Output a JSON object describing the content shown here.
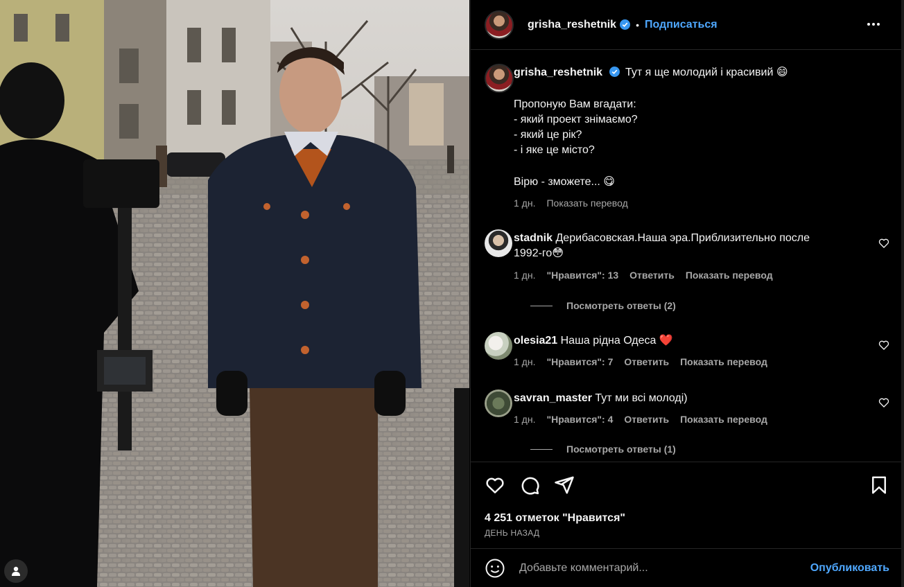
{
  "post": {
    "image_alt": "Photo of a man in a navy coat on a cobblestone street being filmed"
  },
  "header": {
    "username": "grisha_reshetnik",
    "separator": "•",
    "follow_label": "Подписаться",
    "more_icon": "more-horizontal-icon"
  },
  "caption": {
    "username": "grisha_reshetnik",
    "lines": [
      "Тут я ще молодий і красивий 😄",
      "Пропоную Вам вгадати:",
      "- який проект знімаємо?",
      "- який це рік?",
      "- і яке це місто?",
      "Вірю - зможете... 😋"
    ],
    "time": "1 дн.",
    "translate": "Показать перевод"
  },
  "comments": [
    {
      "username": "stadnik",
      "text_line1": "Дерибасовская.Наша эра.Приблизительно после",
      "text_line2": "1992-го😳",
      "time": "1 дн.",
      "likes": "\"Нравится\": 13",
      "reply": "Ответить",
      "translate": "Показать перевод",
      "replies": "Посмотреть ответы (2)"
    },
    {
      "username": "olesia21",
      "text_line1": "Наша рідна Одеса ❤️",
      "time": "1 дн.",
      "likes": "\"Нравится\": 7",
      "reply": "Ответить",
      "translate": "Показать перевод"
    },
    {
      "username": "savran_master",
      "text_line1": "Тут ми всі молоді)",
      "time": "1 дн.",
      "likes": "\"Нравится\": 4",
      "reply": "Ответить",
      "translate": "Показать перевод",
      "replies": "Посмотреть ответы (1)"
    }
  ],
  "footer": {
    "likes_count": "4 251 отметок \"Нравится\"",
    "date": "ДЕНЬ НАЗАД",
    "comment_placeholder": "Добавьте комментарий...",
    "publish_label": "Опубликовать"
  },
  "colors": {
    "accent": "#4fa8ff",
    "muted": "#a8a8a8",
    "background": "#000000",
    "verified": "#3897f0",
    "heart_red": "#ff3040"
  }
}
